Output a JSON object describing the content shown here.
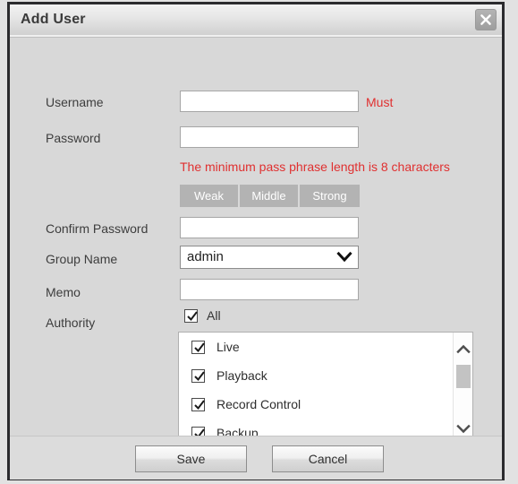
{
  "dialog": {
    "title": "Add User",
    "close_icon": "close-icon"
  },
  "form": {
    "username": {
      "label": "Username",
      "value": "",
      "required_note": "Must"
    },
    "password": {
      "label": "Password",
      "value": "",
      "hint": "The minimum pass phrase length is 8 characters"
    },
    "strength": {
      "levels": [
        "Weak",
        "Middle",
        "Strong"
      ]
    },
    "confirm_password": {
      "label": "Confirm Password",
      "value": ""
    },
    "group_name": {
      "label": "Group Name",
      "value": "admin",
      "chevron_icon": "chevron-down-icon"
    },
    "memo": {
      "label": "Memo",
      "value": ""
    },
    "authority": {
      "label": "Authority",
      "all": {
        "label": "All",
        "checked": true
      },
      "items": [
        {
          "label": "Live",
          "checked": true
        },
        {
          "label": "Playback",
          "checked": true
        },
        {
          "label": "Record Control",
          "checked": true
        },
        {
          "label": "Backup",
          "checked": true
        }
      ],
      "scrollbar": {
        "up_icon": "chevron-up-icon",
        "down_icon": "chevron-down-icon"
      }
    }
  },
  "footer": {
    "save_label": "Save",
    "cancel_label": "Cancel"
  },
  "colors": {
    "dialog_bg": "#d8d8d8",
    "error_text": "#e03030",
    "strength_segment": "#b3b3b3",
    "border_dark": "#2b2b2e"
  }
}
